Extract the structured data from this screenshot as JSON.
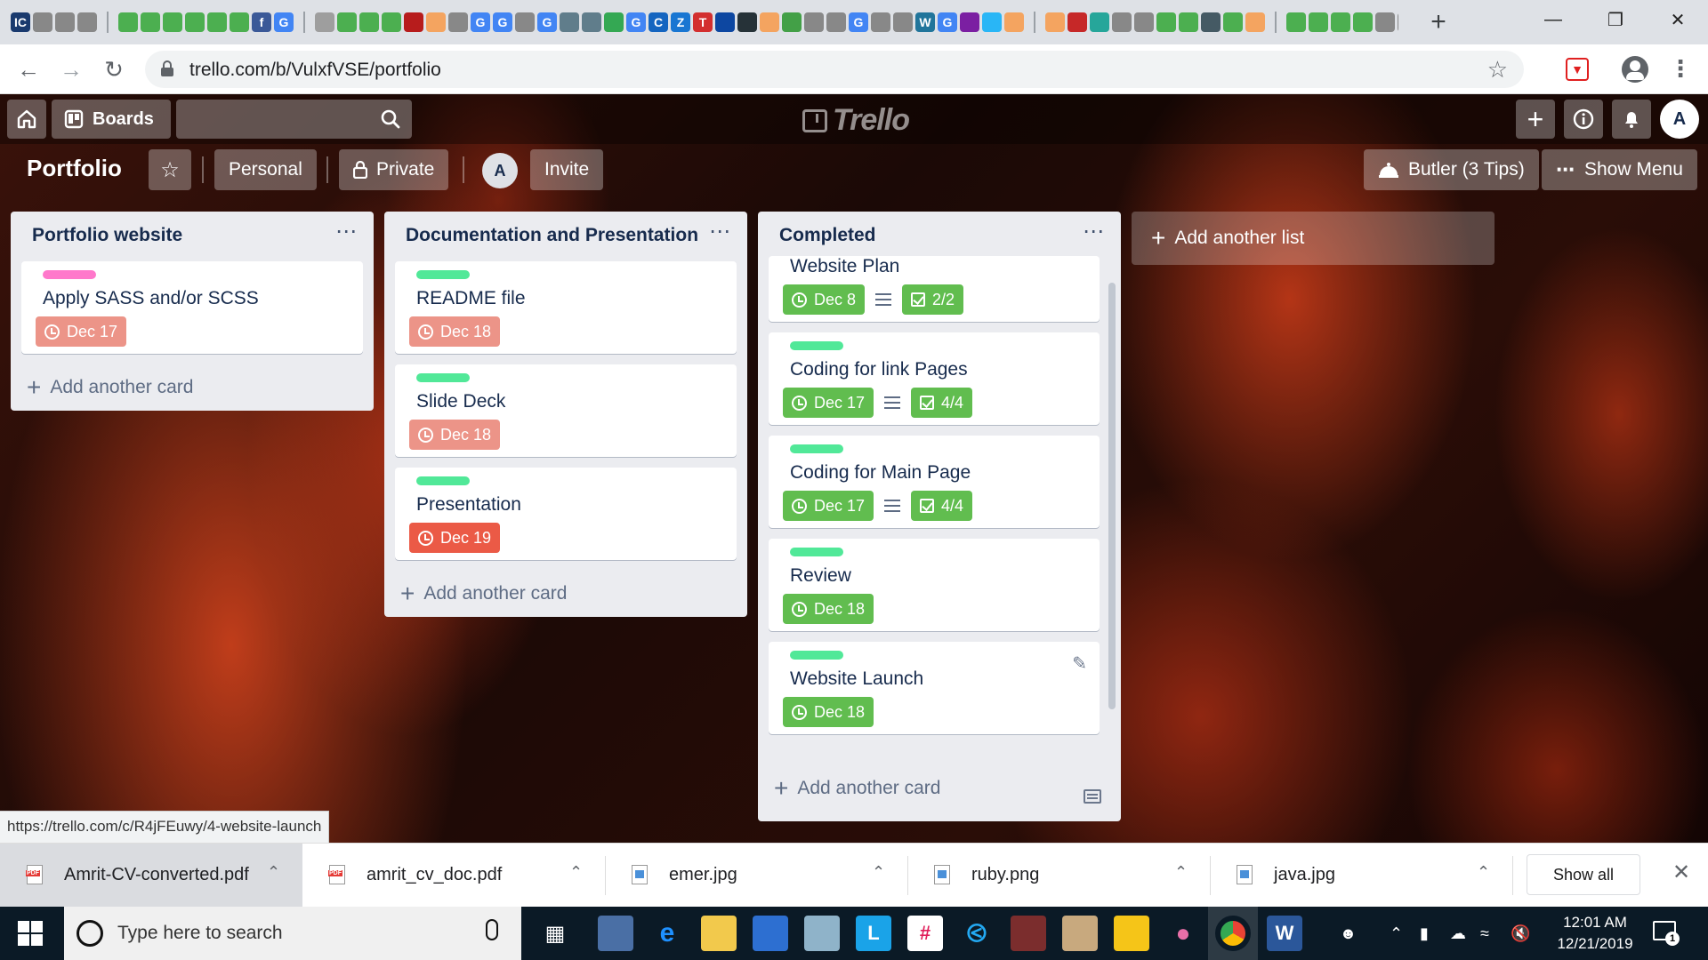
{
  "browser": {
    "url": "trello.com/b/VulxfVSE/portfolio",
    "status_url": "https://trello.com/c/R4jFEuwy/4-website-launch",
    "window_controls": [
      "minimize-icon",
      "restore-icon",
      "close-icon"
    ]
  },
  "topbar": {
    "boards_label": "Boards",
    "avatar_initial": "A"
  },
  "board": {
    "title": "Portfolio",
    "visibility_team": "Personal",
    "visibility": "Private",
    "member_initial": "A",
    "invite_label": "Invite",
    "butler_label": "Butler (3 Tips)",
    "show_menu_label": "Show Menu",
    "add_list_label": "Add another list",
    "add_card_label": "Add another card"
  },
  "colors": {
    "label_pink": "#ff78cb",
    "label_green": "#51e898",
    "due_overdue_light": "#ec9488",
    "due_overdue": "#eb5a46",
    "due_complete": "#61bd4f"
  },
  "lists": [
    {
      "title": "Portfolio website",
      "cards": [
        {
          "label_color": "#ff78cb",
          "title": "Apply SASS and/or SCSS",
          "due": "Dec 17",
          "due_color": "#ec9488"
        }
      ]
    },
    {
      "title": "Documentation and Presentation",
      "cards": [
        {
          "label_color": "#51e898",
          "title": "README file",
          "due": "Dec 18",
          "due_color": "#ec9488"
        },
        {
          "label_color": "#51e898",
          "title": "Slide Deck",
          "due": "Dec 18",
          "due_color": "#ec9488"
        },
        {
          "label_color": "#51e898",
          "title": "Presentation",
          "due": "Dec 19",
          "due_color": "#eb5a46"
        }
      ]
    },
    {
      "title": "Completed",
      "cards": [
        {
          "title": "Website Plan",
          "due": "Dec 8",
          "checklist": "2/2"
        },
        {
          "label_color": "#51e898",
          "title": "Coding for link Pages",
          "due": "Dec 17",
          "checklist": "4/4"
        },
        {
          "label_color": "#51e898",
          "title": "Coding for Main Page",
          "due": "Dec 17",
          "checklist": "4/4"
        },
        {
          "label_color": "#51e898",
          "title": "Review",
          "due": "Dec 18"
        },
        {
          "label_color": "#51e898",
          "title": "Website Launch",
          "due": "Dec 18"
        }
      ]
    }
  ],
  "downloads": {
    "items": [
      {
        "name": "Amrit-CV-converted.pdf",
        "type": "pdf"
      },
      {
        "name": "amrit_cv_doc.pdf",
        "type": "pdf"
      },
      {
        "name": "emer.jpg",
        "type": "image"
      },
      {
        "name": "ruby.png",
        "type": "image"
      },
      {
        "name": "java.jpg",
        "type": "image"
      }
    ],
    "show_all_label": "Show all"
  },
  "taskbar": {
    "search_placeholder": "Type here to search",
    "time": "12:01 AM",
    "date": "12/21/2019",
    "notification_count": "1"
  }
}
